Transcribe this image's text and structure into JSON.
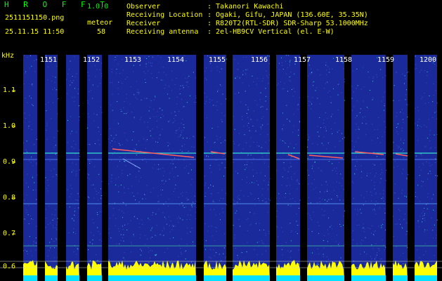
{
  "header": {
    "app_title": "H R O F F T",
    "version": "1.0.0",
    "filename": "2511151150.png",
    "datetime": "25.11.15 11:50",
    "meteor_label": "meteor",
    "meteor_count": "58",
    "info": [
      {
        "label": "Observer",
        "value": ": Takanori Kawachi"
      },
      {
        "label": "Receiving Location",
        "value": ": Ogaki, Gifu, JAPAN (136.60E, 35.35N)"
      },
      {
        "label": "Receiver",
        "value": ": R820T2(RTL-SDR) SDR-Sharp 53.1000MHz"
      },
      {
        "label": "Receiving antenna",
        "value": ": 2el-HB9CV Vertical (el. E-W)"
      }
    ]
  },
  "axis": {
    "unit": "kHz",
    "y_ticks": [
      "1.1",
      "1.0",
      "0.9",
      "0.8",
      "0.7",
      "0.6"
    ],
    "x_ticks": [
      "1151",
      "1152",
      "1153",
      "1154",
      "1155",
      "1156",
      "1157",
      "1158",
      "1159",
      "1200"
    ]
  },
  "colors": {
    "background": "#000000",
    "waterfall": "#1a2a9a",
    "header_text": "#ffff00",
    "tick_text": "#ffffff",
    "signal_line": "#33e0d0",
    "amplitude": "#ffff00",
    "baseline": "#00e0ff"
  }
}
